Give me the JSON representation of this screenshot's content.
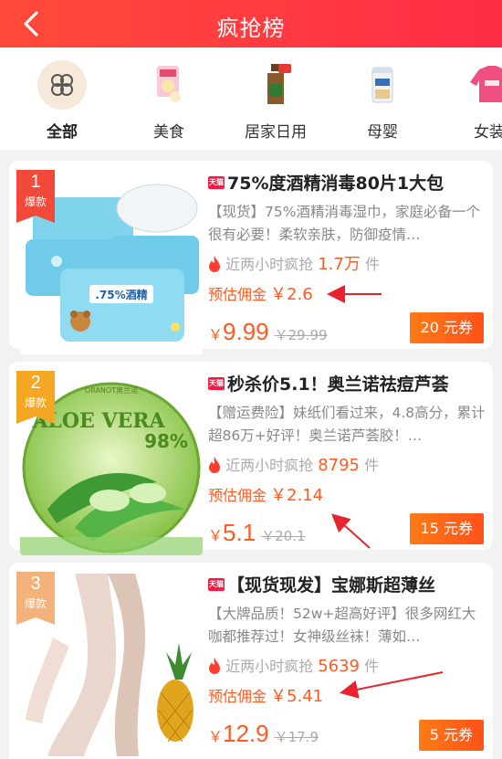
{
  "header": {
    "title": "疯抢榜",
    "back_icon": "back-chevron-icon"
  },
  "categories": [
    {
      "label": "全部",
      "icon": "grid-clover-icon",
      "active": true
    },
    {
      "label": "美食",
      "icon": "snack-package-icon"
    },
    {
      "label": "居家日用",
      "icon": "disinfectant-bottle-icon"
    },
    {
      "label": "母婴",
      "icon": "milk-powder-can-icon"
    },
    {
      "label": "女装",
      "icon": "sweater-icon"
    }
  ],
  "products": [
    {
      "rank": "1",
      "rank_tag": "爆款",
      "platform_badge": "天猫",
      "title": "75%度酒精消毒80片1大包",
      "desc": "【现货】75%酒精消毒湿巾，家庭必备一个很有必要！柔软亲肤，防御疫情…",
      "sales_prefix": "近两小时疯抢",
      "sales_count": "1.7万",
      "sales_unit": "件",
      "commission_label": "预估佣金",
      "commission": "￥2.6",
      "price_symbol": "￥",
      "price": "9.99",
      "original_price": "￥29.99",
      "coupon": "20 元券",
      "image_text": ".75%酒精"
    },
    {
      "rank": "2",
      "rank_tag": "爆款",
      "platform_badge": "天猫",
      "title": "秒杀价5.1！奥兰诺祛痘芦荟",
      "desc": "【赠运费险】妹纸们看过来，4.8高分，累计超86万+好评！奥兰诺芦荟胶！…",
      "sales_prefix": "近两小时疯抢",
      "sales_count": "8795",
      "sales_unit": "件",
      "commission_label": "预估佣金",
      "commission": "￥2.14",
      "price_symbol": "￥",
      "price": "5.1",
      "original_price": "￥20.1",
      "coupon": "15 元券",
      "image_text": "ALOE VERA",
      "image_sub": "98%",
      "image_brand": "ORANOT奥兰诺"
    },
    {
      "rank": "3",
      "rank_tag": "爆款",
      "platform_badge": "天猫",
      "title": "【现货现发】宝娜斯超薄丝",
      "desc": "【大牌品质！52w+超高好评】很多网红大咖都推荐过！女神级丝袜！薄如…",
      "sales_prefix": "近两小时疯抢",
      "sales_count": "5639",
      "sales_unit": "件",
      "commission_label": "预估佣金",
      "commission": "￥5.41",
      "price_symbol": "￥",
      "price": "12.9",
      "original_price": "￥17.9",
      "coupon": "5 元券"
    }
  ],
  "colors": {
    "header": "#ff3b3f",
    "accent": "#ff5a1f",
    "rank1": "#f2493b",
    "rank2": "#f5a623",
    "rank3": "#f3b27c",
    "annotation_arrow": "#e8232e"
  }
}
